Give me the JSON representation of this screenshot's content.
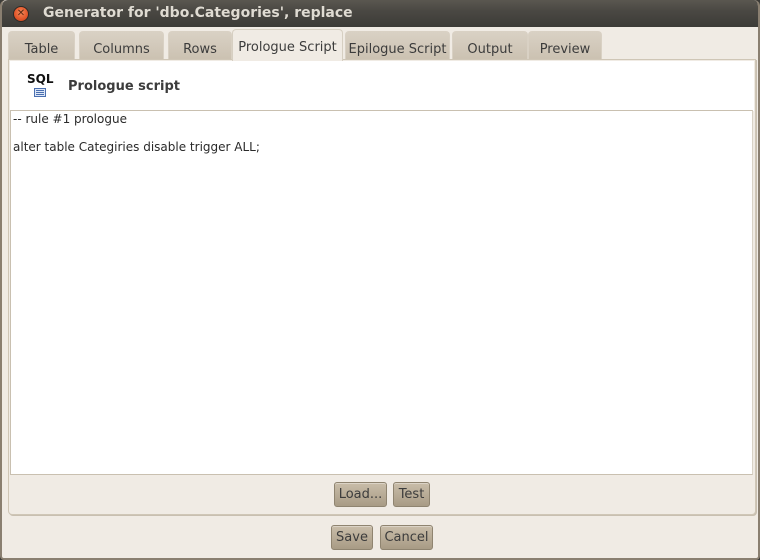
{
  "window": {
    "title": "Generator for 'dbo.Categories', replace",
    "close_icon": "close-icon"
  },
  "tabs": [
    {
      "label": "Table",
      "active": false
    },
    {
      "label": "Columns",
      "active": false
    },
    {
      "label": "Rows",
      "active": false
    },
    {
      "label": "Prologue Script",
      "active": true
    },
    {
      "label": "Epilogue Script",
      "active": false
    },
    {
      "label": "Output",
      "active": false
    },
    {
      "label": "Preview",
      "active": false
    }
  ],
  "header": {
    "icon_text": "SQL",
    "icon": "sql-script-icon",
    "title": "Prologue script"
  },
  "editor": {
    "lines": [
      "-- rule #1 prologue",
      "",
      "alter table Categiries disable trigger ALL;"
    ]
  },
  "panel_buttons": {
    "load": "Load...",
    "test": "Test"
  },
  "dialog_buttons": {
    "save": "Save",
    "cancel": "Cancel"
  },
  "colors": {
    "titlebar": "#3c3b37",
    "window_bg": "#f0ebe4",
    "tab_inactive": "#cbc1b1",
    "close_button": "#e2562a",
    "button": "#b5a891"
  }
}
